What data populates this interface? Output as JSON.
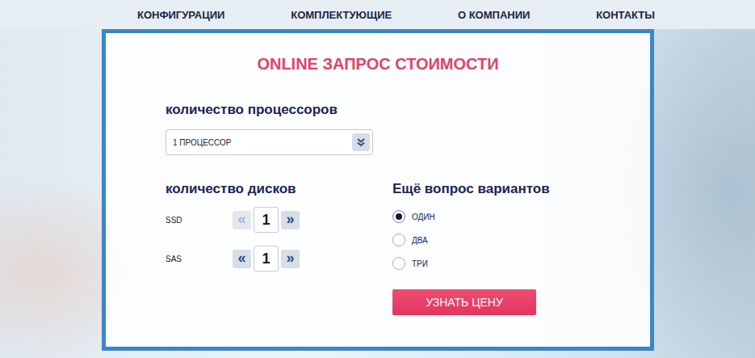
{
  "nav": {
    "items": [
      "КОНФИГУРАЦИИ",
      "КОМПЛЕКТУЮЩИЕ",
      "О КОМПАНИИ",
      "КОНТАКТЫ"
    ]
  },
  "form": {
    "title": "ONLINE ЗАПРОС СТОИМОСТИ",
    "processors": {
      "label": "количество процессоров",
      "value": "1 ПРОЦЕССОР"
    },
    "disks": {
      "label": "количество дисков",
      "rows": [
        {
          "name": "SSD",
          "value": "1",
          "decrement": "«",
          "increment": "»",
          "decrement_disabled": true,
          "increment_disabled": false
        },
        {
          "name": "SAS",
          "value": "1",
          "decrement": "«",
          "increment": "»",
          "decrement_disabled": false,
          "increment_disabled": false
        }
      ]
    },
    "options": {
      "label": "Ещё вопрос вариантов",
      "items": [
        {
          "label": "ОДИН",
          "selected": true
        },
        {
          "label": "ДВА",
          "selected": false
        },
        {
          "label": "ТРИ",
          "selected": false
        }
      ]
    },
    "submit": "УЗНАТЬ ЦЕНУ"
  }
}
